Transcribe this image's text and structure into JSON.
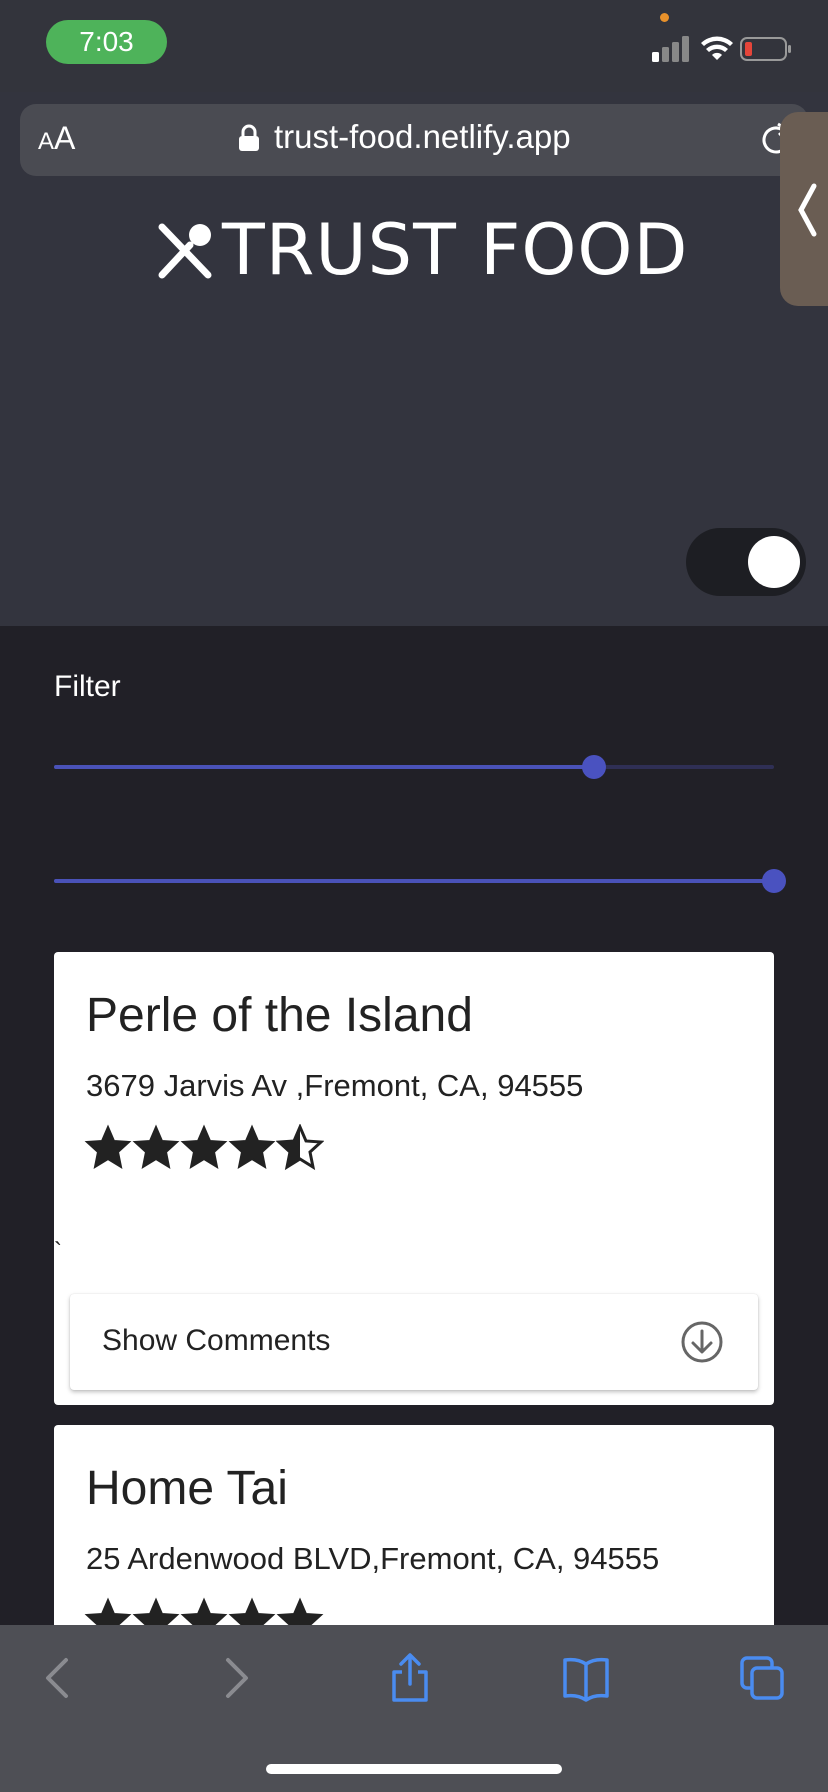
{
  "status_bar": {
    "time": "7:03"
  },
  "browser": {
    "text_size_small": "A",
    "text_size_big": "A",
    "url": "trust-food.netlify.app"
  },
  "header": {
    "brand": "TRUST FOOD",
    "dark_mode_toggle_on": true
  },
  "filter": {
    "label": "Filter",
    "slider_1_value_fraction": 0.75,
    "slider_2_value_fraction": 1.0
  },
  "restaurants": [
    {
      "name": "Perle of the Island",
      "address": "3679 Jarvis Av ,Fremont, CA, 94555",
      "rating": 4.5,
      "stray_text": "`",
      "comments_button": "Show Comments"
    },
    {
      "name": "Home Tai",
      "address": "25 Ardenwood BLVD,Fremont, CA, 94555",
      "rating": 5
    }
  ],
  "colors": {
    "accent": "#4a52b8",
    "status_pill": "#4eb35a",
    "toolbar_icon": "#4a8cf0"
  },
  "toolbar": {
    "icons": [
      "back-icon",
      "forward-icon",
      "share-icon",
      "bookmarks-icon",
      "tabs-icon"
    ]
  }
}
